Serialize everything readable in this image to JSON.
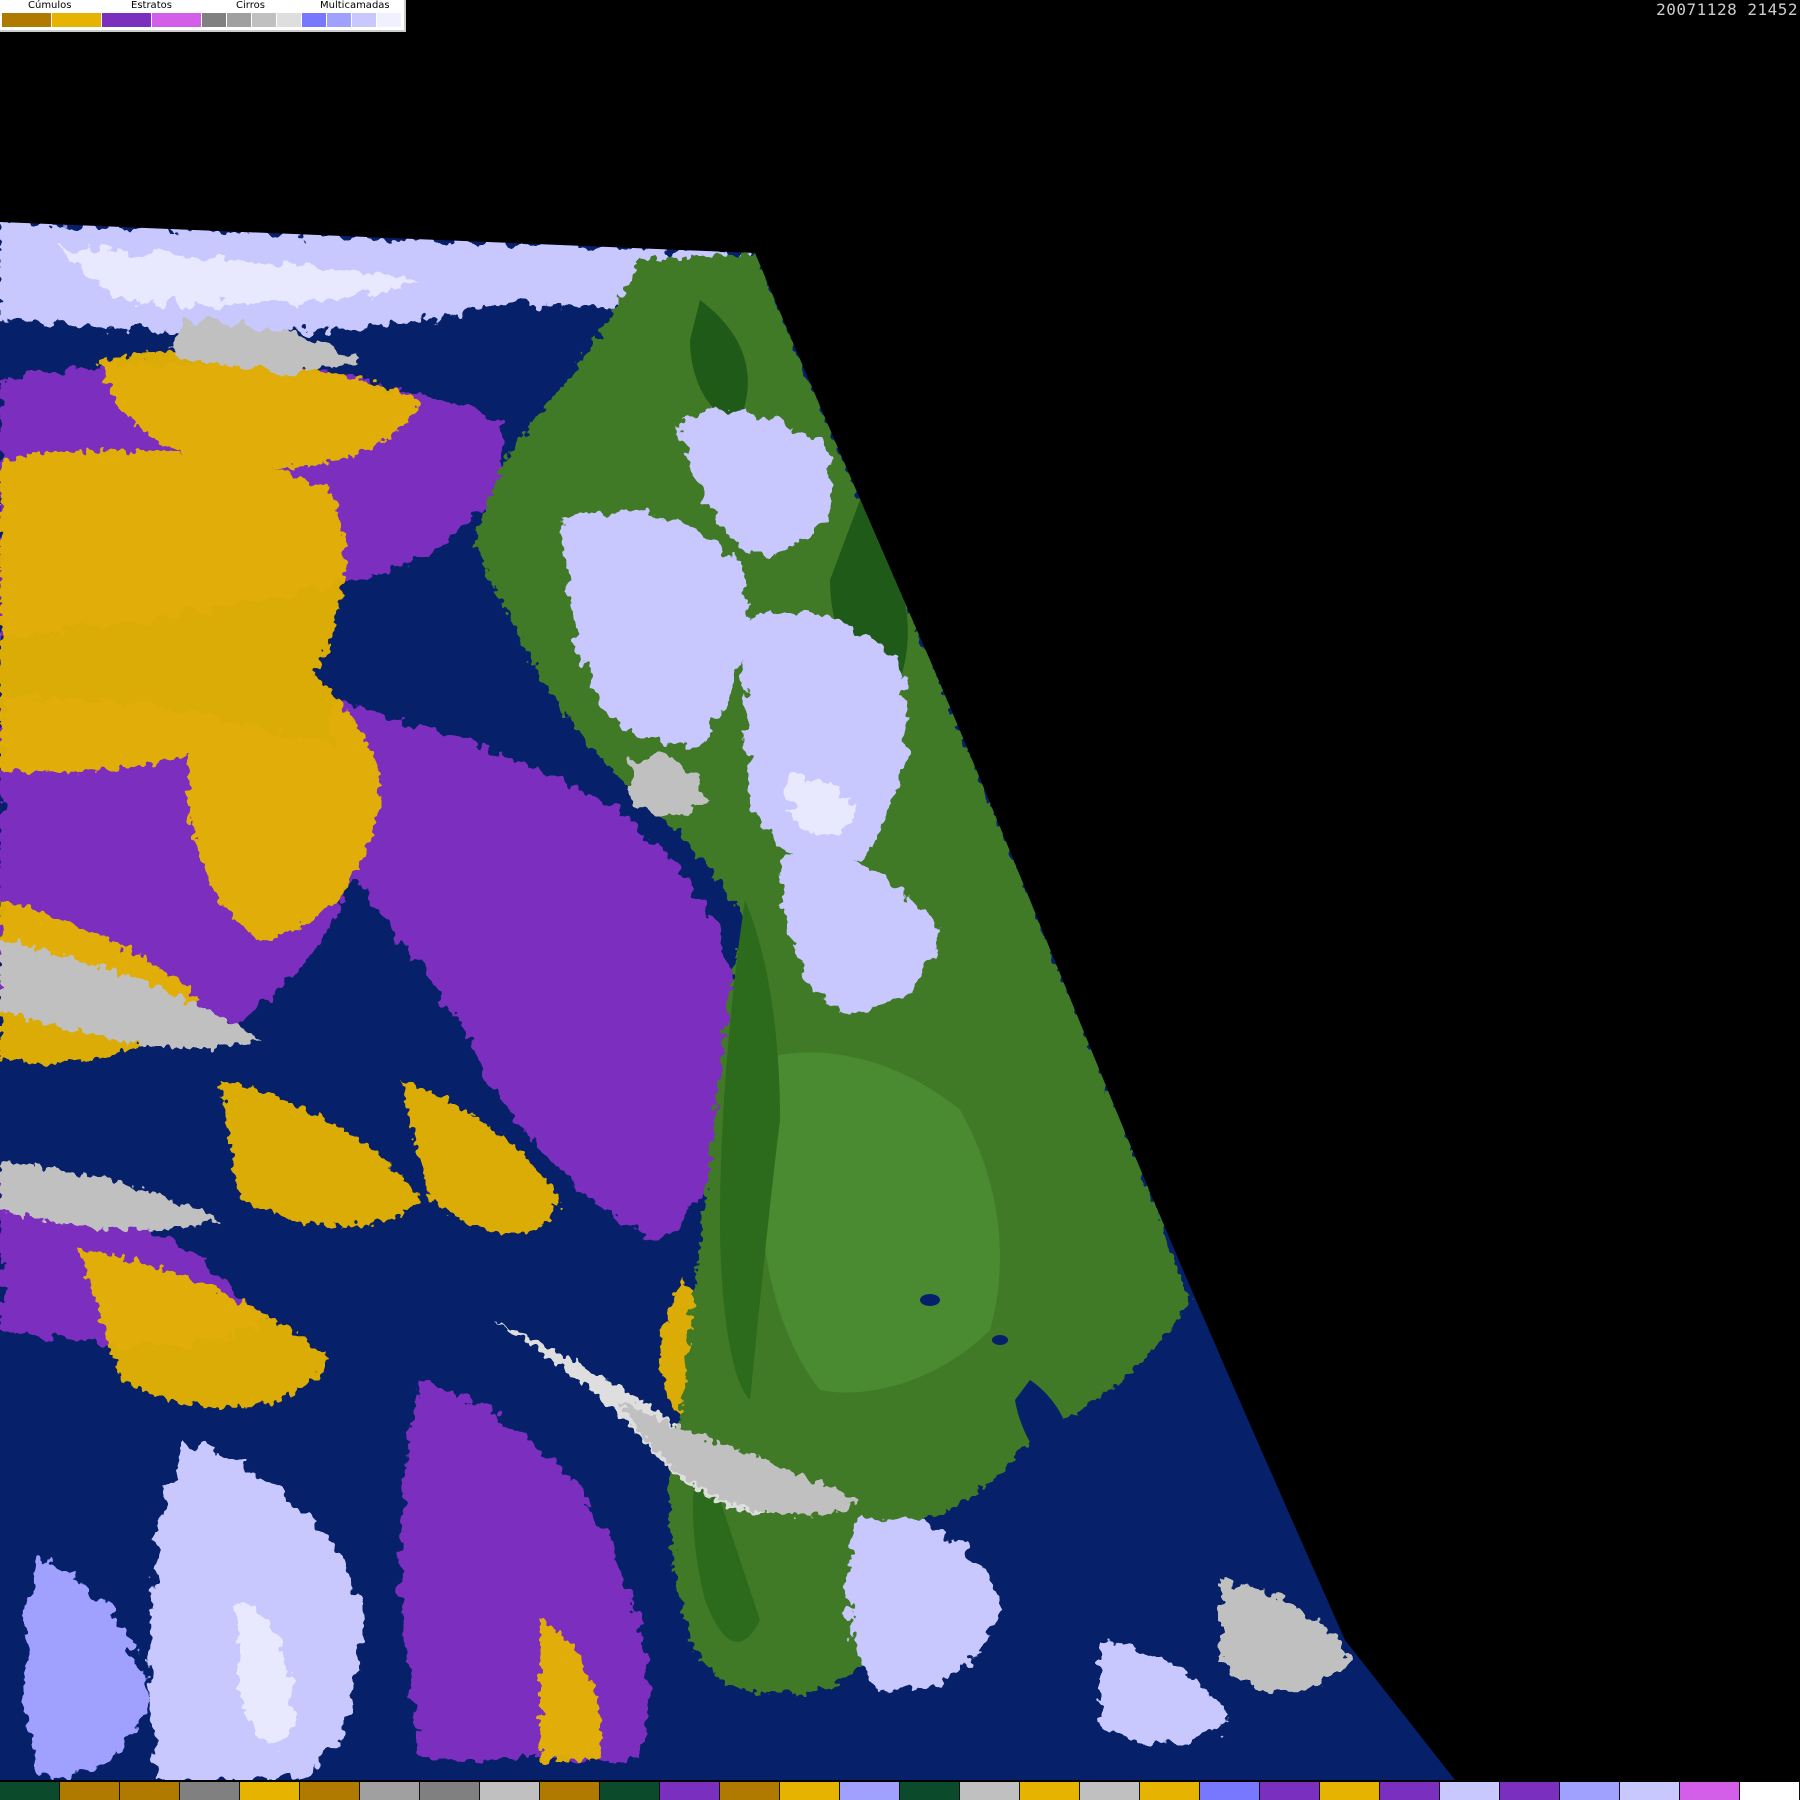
{
  "legend": {
    "groups": [
      {
        "label": "Cúmulos",
        "colors": [
          "#b07a00",
          "#e6b400"
        ]
      },
      {
        "label": "Estratos",
        "colors": [
          "#7b2fbe",
          "#d35ee8"
        ]
      },
      {
        "label": "Cirros",
        "colors": [
          "#808080",
          "#a0a0a0",
          "#c0c0c0",
          "#dedede"
        ]
      },
      {
        "label": "Multicamadas",
        "colors": [
          "#7878ff",
          "#a0a0ff",
          "#c8c8ff",
          "#f0f0ff"
        ]
      }
    ]
  },
  "timestamp": "20071128 21452",
  "bottom_strip": {
    "colors": [
      "#0b4a2a",
      "#b07a00",
      "#b07a00",
      "#808080",
      "#e6b400",
      "#b07a00",
      "#a0a0a0",
      "#808080",
      "#c0c0c0",
      "#b07a00",
      "#0b4a2a",
      "#7b2fbe",
      "#b07a00",
      "#e6b400",
      "#a0a0ff",
      "#0b4a2a",
      "#c0c0c0",
      "#e6b400",
      "#c0c0c0",
      "#e6b400",
      "#7878ff",
      "#7b2fbe",
      "#e6b400",
      "#7b2fbe",
      "#c8c8ff",
      "#7b2fbe",
      "#a0a0ff",
      "#c8c8ff",
      "#d35ee8",
      "#ffffff"
    ]
  },
  "colors": {
    "ocean": "#06206a",
    "land": "#3f7a28",
    "land_dark": "#1f5a18",
    "stratus": "#7b2fbe",
    "cumulus": "#e6b400",
    "multilayer": "#c8c8ff",
    "cirrus": "#c0c0c0"
  }
}
